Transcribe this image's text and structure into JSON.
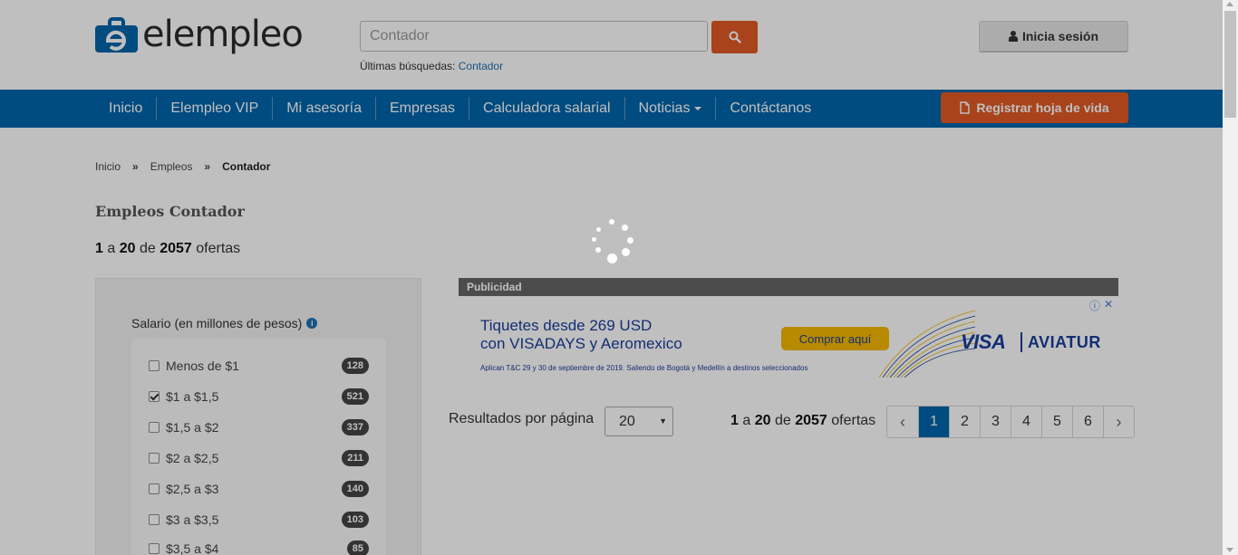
{
  "header": {
    "logo_text": "elempleo",
    "search": {
      "placeholder": "Contador"
    },
    "recent_label": "Últimas búsquedas:",
    "recent_link": "Contador",
    "login_label": "Inicia sesión"
  },
  "nav": {
    "items": [
      {
        "label": "Inicio"
      },
      {
        "label": "Elempleo VIP"
      },
      {
        "label": "Mi asesoría"
      },
      {
        "label": "Empresas"
      },
      {
        "label": "Calculadora salarial"
      },
      {
        "label": "Noticias"
      },
      {
        "label": "Contáctanos"
      }
    ],
    "register_label": "Registrar hoja de vida"
  },
  "breadcrumb": {
    "items": [
      "Inicio",
      "Empleos",
      "Contador"
    ],
    "separator": "»"
  },
  "page": {
    "title": "Empleos Contador",
    "range_start": "1",
    "range_end": "20",
    "total": "2057",
    "a_word": "a",
    "de_word": "de",
    "ofertas_word": "ofertas"
  },
  "filter": {
    "title": "Salario (en millones de pesos)",
    "info_glyph": "i",
    "options": [
      {
        "label": "Menos de $1",
        "count": "128",
        "checked": false
      },
      {
        "label": "$1 a $1,5",
        "count": "521",
        "checked": true
      },
      {
        "label": "$1,5 a $2",
        "count": "337",
        "checked": false
      },
      {
        "label": "$2 a $2,5",
        "count": "211",
        "checked": false
      },
      {
        "label": "$2,5 a $3",
        "count": "140",
        "checked": false
      },
      {
        "label": "$3 a $3,5",
        "count": "103",
        "checked": false
      },
      {
        "label": "$3,5 a $4",
        "count": "85",
        "checked": false
      }
    ]
  },
  "ad": {
    "header": "Publicidad",
    "line1": "Tiquetes desde 269 USD",
    "line2": "con VISADAYS y Aeromexico",
    "small": "Aplican T&C 29 y 30 de septiembre de 2019. Saliendo de Bogotá y Medellín a destinos seleccionados",
    "cta": "Comprar aquí",
    "brand1": "VISA",
    "brand2": "AVIATUR",
    "icon_info": "ⓘ",
    "icon_close": "✕"
  },
  "results_bar": {
    "per_page_label": "Resultados por página",
    "per_page_value": "20",
    "pages": [
      "1",
      "2",
      "3",
      "4",
      "5",
      "6"
    ],
    "active_page": "1",
    "prev_glyph": "‹",
    "next_glyph": "›"
  },
  "colors": {
    "brand_blue": "#0064aa",
    "accent_orange": "#e15a26"
  }
}
